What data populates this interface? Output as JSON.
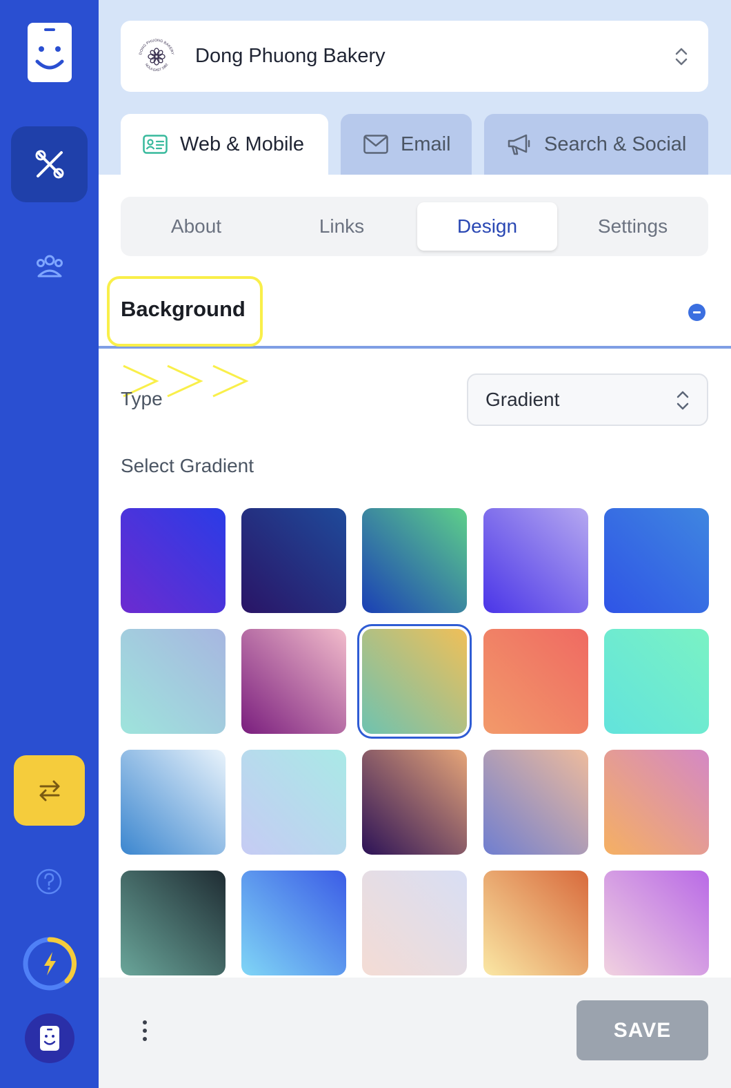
{
  "business": {
    "name": "Dong Phuong Bakery",
    "logo_text_top": "DONG PHUONG BAKERY",
    "logo_text_bottom": "NOLA EAST 1982"
  },
  "main_tabs": [
    {
      "label": "Web & Mobile",
      "icon": "id-card-icon",
      "active": true
    },
    {
      "label": "Email",
      "icon": "envelope-icon",
      "active": false
    },
    {
      "label": "Search & Social",
      "icon": "megaphone-icon",
      "active": false
    }
  ],
  "sub_tabs": [
    {
      "label": "About",
      "active": false
    },
    {
      "label": "Links",
      "active": false
    },
    {
      "label": "Design",
      "active": true
    },
    {
      "label": "Settings",
      "active": false
    }
  ],
  "section": {
    "title": "Background"
  },
  "annotation": {
    "arrows": ">>>"
  },
  "type_field": {
    "label": "Type",
    "value": "Gradient"
  },
  "gradients": {
    "label": "Select Gradient",
    "selected_index": 7,
    "items": [
      {
        "from": "#6c2bd0",
        "to": "#2a3ce6"
      },
      {
        "from": "#2a1466",
        "to": "#1f4a9a"
      },
      {
        "from": "#1a3fb5",
        "to": "#5ed08a"
      },
      {
        "from": "#4a35e8",
        "to": "#b5a8f0"
      },
      {
        "from": "#2f54e6",
        "to": "#3f86e0"
      },
      {
        "from": "#9ee4dc",
        "to": "#a7b6e0"
      },
      {
        "from": "#7a1e7e",
        "to": "#f2bccb"
      },
      {
        "from": "#6ec2b0",
        "to": "#f0bf58"
      },
      {
        "from": "#f29a6a",
        "to": "#ef6a62"
      },
      {
        "from": "#62e3dc",
        "to": "#7af2c4"
      },
      {
        "from": "#3b86cf",
        "to": "#e9f3fb"
      },
      {
        "from": "#c6cbf4",
        "to": "#a9e9e6"
      },
      {
        "from": "#2c1257",
        "to": "#e6a578"
      },
      {
        "from": "#6f7ed0",
        "to": "#eebb9c"
      },
      {
        "from": "#f5b062",
        "to": "#d488c5"
      },
      {
        "from": "#6aa69a",
        "to": "#1f2c33"
      },
      {
        "from": "#80d6f6",
        "to": "#3b5ce6"
      },
      {
        "from": "#f4dcd4",
        "to": "#d8def4"
      },
      {
        "from": "#fae8a5",
        "to": "#d86a3c"
      },
      {
        "from": "#f1d2e0",
        "to": "#b96ae6"
      }
    ]
  },
  "footer": {
    "save_label": "SAVE",
    "more_icon": "more-vertical-icon"
  },
  "colors": {
    "sidebar": "#2a4fd1",
    "accent": "#2947b3",
    "swap_button": "#f5cc3c",
    "save_disabled": "#9ba3ae",
    "highlight": "#f9ef4a"
  }
}
